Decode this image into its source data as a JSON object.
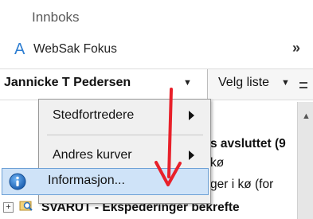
{
  "header": {
    "inbox_title": "Innboks",
    "app_logo_letter": "A",
    "app_name": "WebSak Fokus",
    "chevron": "»"
  },
  "selectors": {
    "user_label": "Jannicke T Pedersen",
    "list_label": "Velg liste"
  },
  "popup_menu": {
    "items": [
      {
        "label": "Stedfortredere",
        "has_submenu": true
      },
      {
        "label": "Andres kurver",
        "has_submenu": true
      },
      {
        "label": "Informasjon...",
        "has_submenu": false,
        "highlighted": true
      }
    ]
  },
  "background_list": {
    "row1": "s avsluttet (9",
    "row2": "kø",
    "row3": "ger i kø (for",
    "row4": "SVARUT - Ekspederinger bekrefte"
  },
  "colors": {
    "highlight_bg": "#cfe3f8",
    "highlight_border": "#6ea1d6",
    "arrow": "#e8202a",
    "info_icon": "#1c6fc4"
  }
}
